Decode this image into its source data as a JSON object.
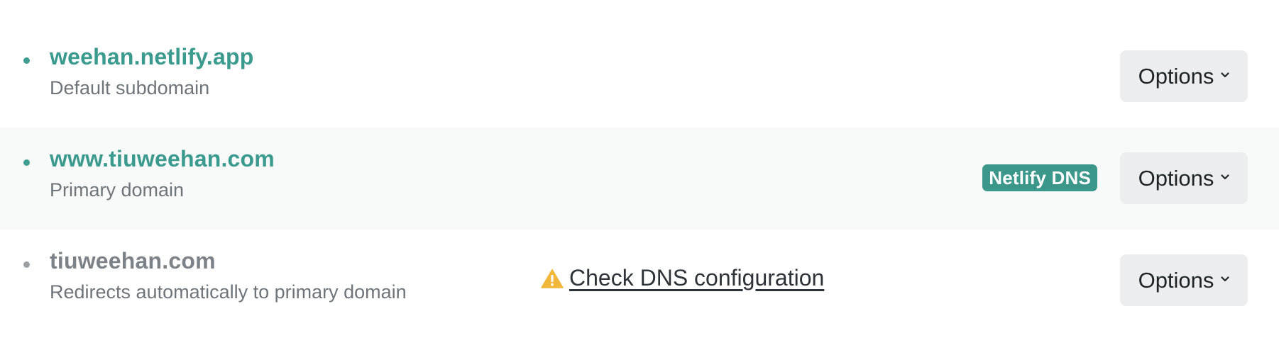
{
  "domains": [
    {
      "name": "weehan.netlify.app",
      "description": "Default subdomain",
      "options_label": "Options"
    },
    {
      "name": "www.tiuweehan.com",
      "description": "Primary domain",
      "badge": "Netlify DNS",
      "options_label": "Options"
    },
    {
      "name": "tiuweehan.com",
      "description": "Redirects automatically to primary domain",
      "warning_link": "Check DNS configuration",
      "options_label": "Options"
    }
  ],
  "colors": {
    "accent": "#3a9a8d",
    "muted_text": "#7c8388",
    "badge_bg": "#3c978b",
    "warning": "#f0b73a",
    "button_bg": "#ebedee"
  },
  "icons": {
    "dropdown": "chevron-down-icon",
    "warning": "warning-icon"
  }
}
